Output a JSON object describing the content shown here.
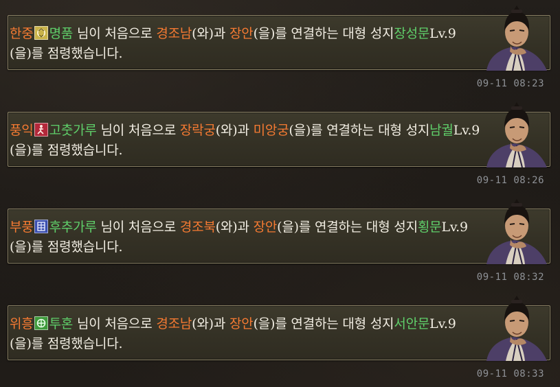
{
  "feed": {
    "entries": [
      {
        "user": "한중",
        "emblem": {
          "icon": "tiger-crest-icon",
          "color": "#c9b34a"
        },
        "nick": "명품",
        "t1": " 님이 처음으로 ",
        "city_a": "경조남",
        "t2": "(와)과 ",
        "city_b": "장안",
        "t3": "(을)를 연결하는 대형 성지",
        "holy": "장성문",
        "lv": "Lv.9",
        "t4": " (을)를 점령했습니다.",
        "time": "09-11 08:23"
      },
      {
        "user": "풍익",
        "emblem": {
          "icon": "runner-crest-icon",
          "color": "#b3283a"
        },
        "nick": "고춧가루",
        "t1": " 님이 처음으로 ",
        "city_a": "장락궁",
        "t2": "(와)과 ",
        "city_b": "미앙궁",
        "t3": "(을)를 연결하는 대형 성지",
        "holy": "남궐",
        "lv": "Lv.9",
        "t4": " (을)를 점령했습니다.",
        "time": "09-11 08:26"
      },
      {
        "user": "부풍",
        "emblem": {
          "icon": "ornament-crest-icon",
          "color": "#3b4fb0"
        },
        "nick": "후추가루",
        "t1": " 님이 처음으로 ",
        "city_a": "경조북",
        "t2": "(와)과 ",
        "city_b": "장안",
        "t3": "(을)를 연결하는 대형 성지",
        "holy": "횡문",
        "lv": "Lv.9",
        "t4": " (을)를 점령했습니다.",
        "time": "09-11 08:32"
      },
      {
        "user": "위흥",
        "emblem": {
          "icon": "shield-crest-icon",
          "color": "#3f9a3c"
        },
        "nick": "투혼",
        "t1": " 님이 처음으로 ",
        "city_a": "경조남",
        "t2": "(와)과 ",
        "city_b": "장안",
        "t3": "(을)를 연결하는 대형 성지",
        "holy": "서안문",
        "lv": "Lv.9",
        "t4": " (을)를 점령했습니다.",
        "time": "09-11 08:33"
      }
    ]
  }
}
